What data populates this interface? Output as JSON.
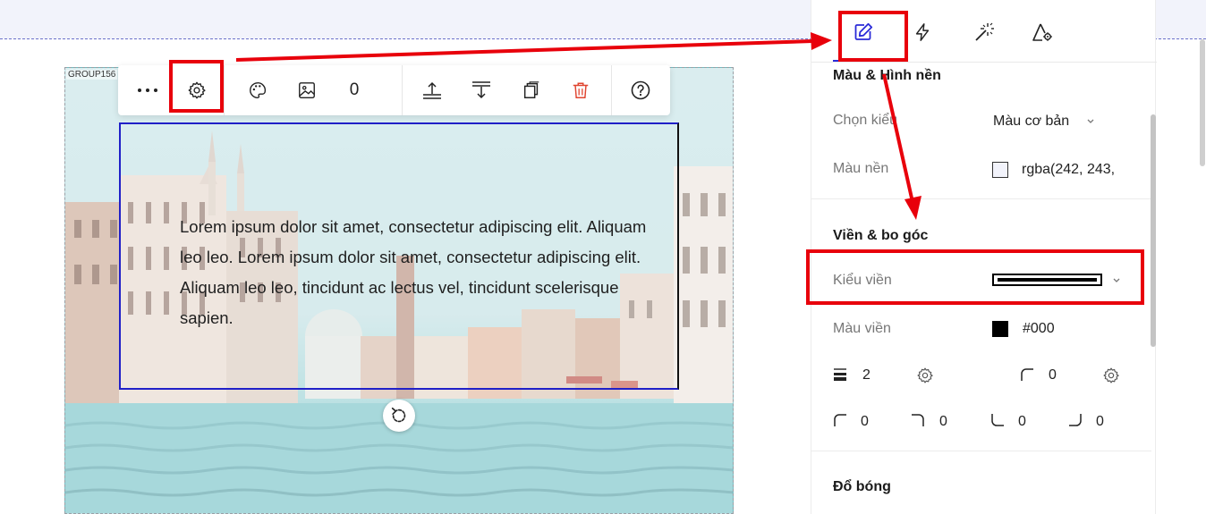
{
  "canvas": {
    "group_label": "GROUP156",
    "text_content": "Lorem ipsum dolor sit amet, consectetur adipiscing elit. Aliquam leo leo. Lorem ipsum dolor sit amet, consectetur adipiscing elit. Aliquam leo leo, tincidunt ac lectus vel, tincidunt scelerisque sapien."
  },
  "toolbar": {
    "image_count": "0"
  },
  "panel": {
    "tabs": [
      "edit-icon",
      "lightning-icon",
      "magic-wand-icon",
      "settings-triangle-icon"
    ],
    "background_section": {
      "title": "Màu & Hình nền",
      "style_label": "Chọn kiểu",
      "style_value": "Màu cơ bản",
      "bg_color_label": "Màu nền",
      "bg_color_value": "rgba(242, 243,"
    },
    "border_section": {
      "title": "Viền & bo góc",
      "border_style_label": "Kiểu viền",
      "border_color_label": "Màu viền",
      "border_color_value": "#000",
      "border_width": "2",
      "corner_all": "0",
      "corner_top_left": "0",
      "corner_top_right": "0",
      "corner_bottom_left": "0",
      "corner_bottom_right": "0"
    },
    "shadow_section": {
      "title": "Đổ bóng"
    }
  },
  "colors": {
    "accent": "#2b2bd8",
    "annotation_red": "#e8000b",
    "delete_red": "#e0442f"
  }
}
